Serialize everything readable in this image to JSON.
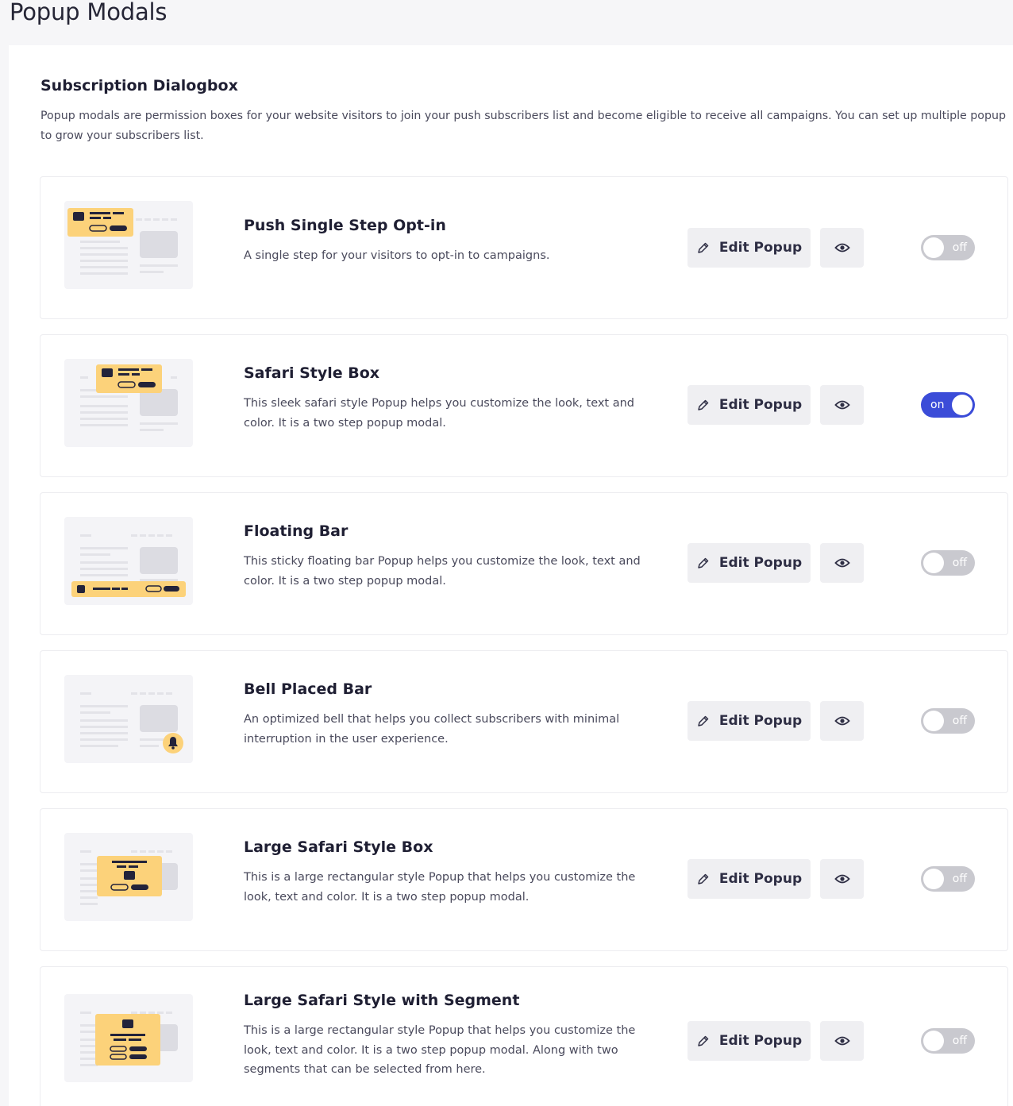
{
  "page": {
    "title": "Popup Modals"
  },
  "section": {
    "title": "Subscription Dialogbox",
    "description": "Popup modals are permission boxes for your website visitors to join your push subscribers list and become eligible to receive all campaigns. You can set up multiple popup to grow your subscribers list."
  },
  "colors": {
    "accent": "#3b4cd8",
    "highlight": "#fcd27a",
    "toggle_off": "#c9c9cf"
  },
  "popups": [
    {
      "title": "Push Single Step Opt-in",
      "description": "A single step for your visitors to opt-in to campaigns.",
      "edit_label": "Edit Popup",
      "toggle_label": "off",
      "enabled": false,
      "preview_icon": "eye-icon"
    },
    {
      "title": "Safari Style Box",
      "description": "This sleek safari style Popup helps you customize the look, text and color. It is a two step popup modal.",
      "edit_label": "Edit Popup",
      "toggle_label": "on",
      "enabled": true,
      "preview_icon": "eye-icon"
    },
    {
      "title": "Floating Bar",
      "description": "This sticky floating bar Popup helps you customize the look, text and color. It is a two step popup modal.",
      "edit_label": "Edit Popup",
      "toggle_label": "off",
      "enabled": false,
      "preview_icon": "eye-icon"
    },
    {
      "title": "Bell Placed Bar",
      "description": "An optimized bell that helps you collect subscribers with minimal interruption in the user experience.",
      "edit_label": "Edit Popup",
      "toggle_label": "off",
      "enabled": false,
      "preview_icon": "eye-icon"
    },
    {
      "title": "Large Safari Style Box",
      "description": "This is a large rectangular style Popup that helps you customize the look, text and color. It is a two step popup modal.",
      "edit_label": "Edit Popup",
      "toggle_label": "off",
      "enabled": false,
      "preview_icon": "eye-icon"
    },
    {
      "title": "Large Safari Style with Segment",
      "description": "This is a large rectangular style Popup that helps you customize the look, text and color. It is a two step popup modal. Along with two segments that can be selected from here.",
      "edit_label": "Edit Popup",
      "toggle_label": "off",
      "enabled": false,
      "preview_icon": "eye-icon"
    }
  ]
}
